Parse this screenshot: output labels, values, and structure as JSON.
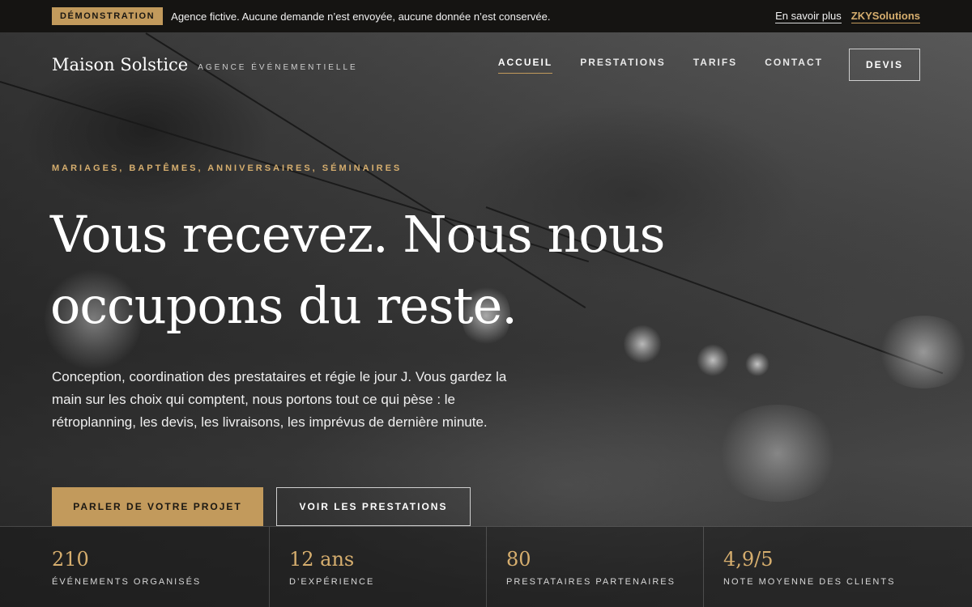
{
  "banner": {
    "badge": "DÉMONSTRATION",
    "text": "Agence fictive. Aucune demande n’est envoyée, aucune donnée n’est conservée.",
    "learn_more": "En savoir plus",
    "brand": "ZKYSolutions"
  },
  "header": {
    "logo": "Maison Solstice",
    "tagline": "AGENCE ÉVÉNEMENTIELLE",
    "nav": [
      "ACCUEIL",
      "PRESTATIONS",
      "TARIFS",
      "CONTACT"
    ],
    "active_nav": "ACCUEIL",
    "cta": "DEVIS"
  },
  "hero": {
    "eyebrow": "MARIAGES, BAPTÊMES, ANNIVERSAIRES, SÉMINAIRES",
    "headline_line1": "Vous recevez. Nous nous",
    "headline_line2": "occupons du reste.",
    "lead": "Conception, coordination des prestataires et régie le jour J. Vous gardez la main sur les choix qui comptent, nous portons tout ce qui pèse : le rétroplanning, les devis, les livraisons, les imprévus de dernière minute.",
    "primary_cta": "PARLER DE VOTRE PROJET",
    "secondary_cta": "VOIR LES PRESTATIONS"
  },
  "stats": [
    {
      "value": "210",
      "label": "ÉVÉNEMENTS ORGANISÉS"
    },
    {
      "value": "12 ans",
      "label": "D’EXPÉRIENCE"
    },
    {
      "value": "80",
      "label": "PRESTATAIRES PARTENAIRES"
    },
    {
      "value": "4,9/5",
      "label": "NOTE MOYENNE DES CLIENTS"
    }
  ],
  "colors": {
    "accent": "#c29a5c",
    "banner_bg": "#151412",
    "text": "#ffffff"
  }
}
